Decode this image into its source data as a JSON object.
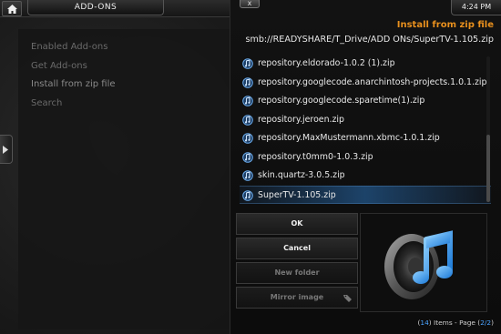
{
  "window": {
    "title": "ADD-ONS",
    "clock": "4:24 PM",
    "close_label": "x"
  },
  "sidebar": {
    "items": [
      {
        "label": "Enabled Add-ons"
      },
      {
        "label": "Get Add-ons"
      },
      {
        "label": "Install from zip file"
      },
      {
        "label": "Search"
      }
    ]
  },
  "dialog": {
    "heading": "Install from zip file",
    "path": "smb://READYSHARE/T_Drive/ADD ONs/SuperTV-1.105.zip",
    "files": [
      {
        "name": "repository.eldorado-1.0.2 (1).zip"
      },
      {
        "name": "repository.googlecode.anarchintosh-projects.1.0.1.zip"
      },
      {
        "name": "repository.googlecode.sparetime(1).zip"
      },
      {
        "name": "repository.jeroen.zip"
      },
      {
        "name": "repository.MaxMustermann.xbmc-1.0.1.zip"
      },
      {
        "name": "repository.t0mm0-1.0.3.zip"
      },
      {
        "name": "skin.quartz-3.0.5.zip"
      },
      {
        "name": "SuperTV-1.105.zip"
      }
    ],
    "selected_index": 7,
    "buttons": {
      "ok": "OK",
      "cancel": "Cancel",
      "new_folder": "New folder",
      "mirror_image": "Mirror image"
    },
    "thumbnail_icon": "music-speaker-icon",
    "page_info": {
      "open_paren": "(",
      "items_count": "14",
      "items_text": ") Items - Page (",
      "page_current": "2",
      "page_sep": "/",
      "page_total": "2",
      "close_paren": ")"
    }
  },
  "colors": {
    "heading": "#e8901e",
    "selection": "#2a6eb4",
    "count_accent": "#4aa3ff"
  }
}
